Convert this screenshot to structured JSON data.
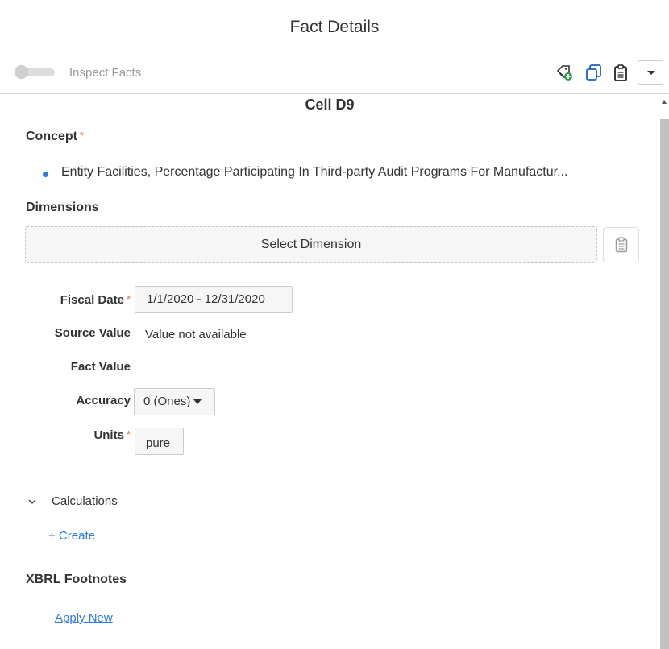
{
  "header": {
    "title": "Fact Details"
  },
  "toolbar": {
    "inspect_label": "Inspect Facts",
    "inspect_enabled": false,
    "icons": [
      "tag-add-icon",
      "copy-icon",
      "clipboard-icon",
      "chevron-down-icon"
    ]
  },
  "cell": {
    "title": "Cell D9"
  },
  "concept": {
    "label": "Concept",
    "required_mark": "*",
    "value": "Entity Facilities, Percentage Participating In Third-party Audit Programs For Manufactur..."
  },
  "dimensions": {
    "label": "Dimensions",
    "select_label": "Select Dimension"
  },
  "fields": {
    "fiscal_date": {
      "label": "Fiscal Date",
      "required_mark": "*",
      "value": "1/1/2020 - 12/31/2020"
    },
    "source_value": {
      "label": "Source Value",
      "value": "Value not available"
    },
    "fact_value": {
      "label": "Fact Value"
    },
    "accuracy": {
      "label": "Accuracy",
      "value": "0 (Ones)"
    },
    "units": {
      "label": "Units",
      "required_mark": "*",
      "value": "pure"
    }
  },
  "calculations": {
    "label": "Calculations",
    "create_label": "+ Create"
  },
  "footnotes": {
    "label": "XBRL Footnotes",
    "apply_label": "Apply New"
  },
  "colors": {
    "accent": "#2d7be5",
    "required": "#e8743b"
  }
}
